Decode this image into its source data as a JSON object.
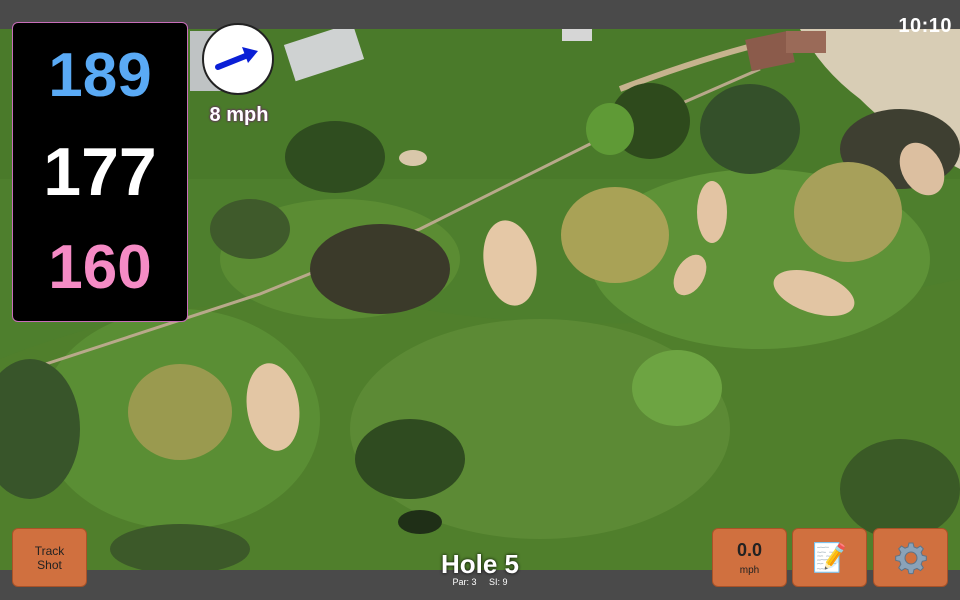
{
  "status": {
    "time": "10:10"
  },
  "distances": {
    "back": "189",
    "middle": "177",
    "front": "160"
  },
  "wind": {
    "speed": "8 mph",
    "direction_icon": "arrow-icon"
  },
  "buttons": {
    "track_shot": {
      "line1": "Track",
      "line2": "Shot"
    },
    "shot_speed": {
      "value": "0.0",
      "unit": "mph"
    },
    "notes": {
      "icon": "notepad-icon",
      "glyph": "📝"
    },
    "settings": {
      "icon": "gear-icon"
    }
  },
  "hole": {
    "title": "Hole 5",
    "par": "Par: 3",
    "si": "SI: 9"
  },
  "colors": {
    "back_yardage": "#5aaaf5",
    "middle_yardage": "#ffffff",
    "front_yardage": "#f58bc5",
    "button": "#d0703f",
    "wind_arrow": "#0a1fd6"
  }
}
